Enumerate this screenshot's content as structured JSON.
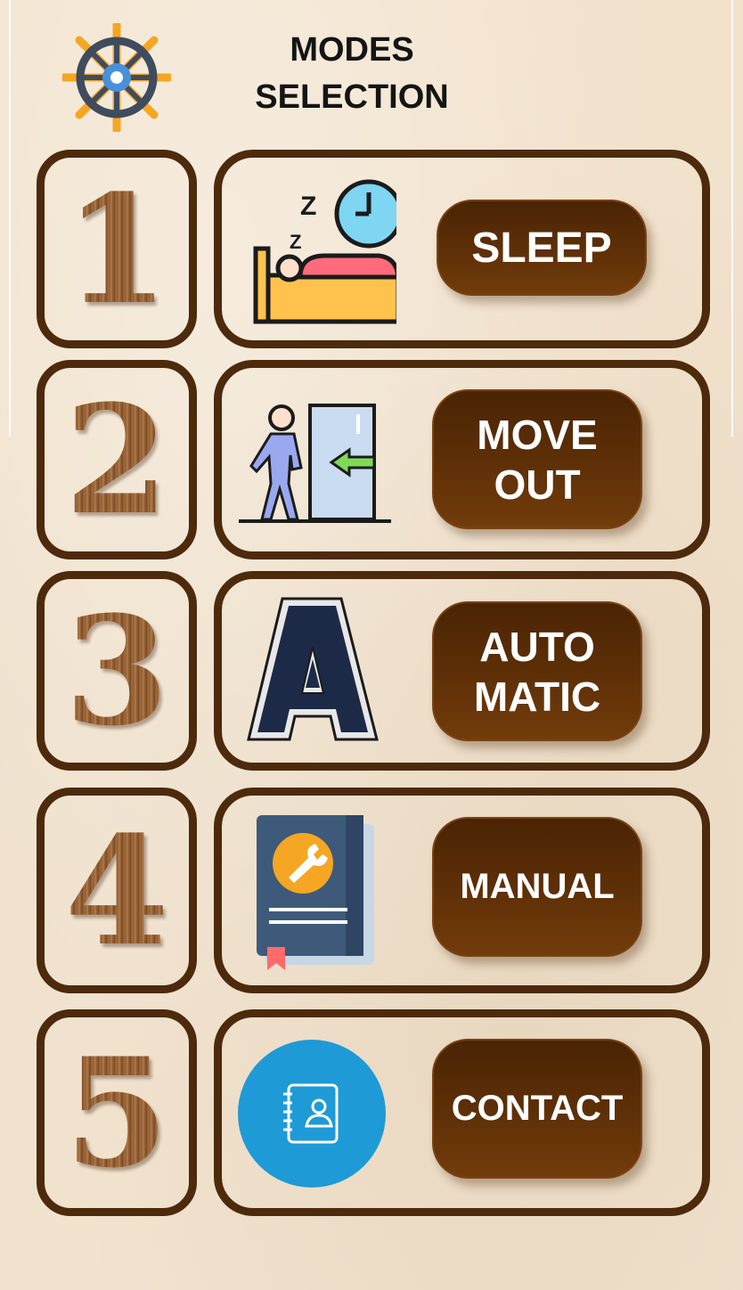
{
  "header": {
    "title_line1": "MODES",
    "title_line2": "SELECTION",
    "logo_icon": "ship-wheel-icon"
  },
  "modes": [
    {
      "number": "1",
      "label_line1": "SLEEP",
      "label_line2": "",
      "icon": "sleeping-bed-clock-icon"
    },
    {
      "number": "2",
      "label_line1": "MOVE",
      "label_line2": "OUT",
      "icon": "person-exiting-door-icon"
    },
    {
      "number": "3",
      "label_line1": "AUTO",
      "label_line2": "MATIC",
      "icon": "varsity-letter-a-icon"
    },
    {
      "number": "4",
      "label_line1": "MANUAL",
      "label_line2": "",
      "icon": "manual-book-wrench-icon"
    },
    {
      "number": "5",
      "label_line1": "CONTACT",
      "label_line2": "",
      "icon": "contact-book-icon"
    }
  ],
  "colors": {
    "frame": "#4d2a0c",
    "button_top": "#4a2404",
    "button_bottom": "#723c0b",
    "background": "#f2e2cc"
  }
}
